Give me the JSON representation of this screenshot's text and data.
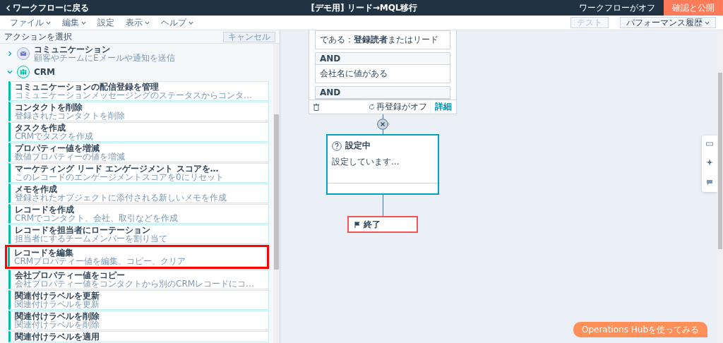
{
  "top_bar": {
    "back_link": "ワークフローに戻る",
    "title": "[デモ用] リード→MQL移行",
    "status": "ワークフローがオフ",
    "publish_button": "確認と公開"
  },
  "menu_bar": {
    "menus": [
      {
        "label": "ファイル",
        "dropdown": true
      },
      {
        "label": "編集",
        "dropdown": true
      },
      {
        "label": "設定",
        "dropdown": false
      },
      {
        "label": "表示",
        "dropdown": true
      },
      {
        "label": "ヘルプ",
        "dropdown": true
      }
    ],
    "buttons": [
      {
        "label": "テスト",
        "disabled": true,
        "dropdown": false
      },
      {
        "label": "パフォーマンス履歴",
        "disabled": false,
        "dropdown": true
      }
    ]
  },
  "sidebar": {
    "title": "アクションを選択",
    "cancel_button": "キャンセル",
    "categories": [
      {
        "name": "コミュニケーション",
        "description": "顧客やチームにEメールや通知を送信",
        "kind": "mail",
        "expanded": false
      },
      {
        "name": "CRM",
        "kind": "people",
        "expanded": true,
        "children": [
          {
            "title": "コミュニケーションの配信登録を管理",
            "description": "コミュニケーションメッセージングのステータスからコンタ…",
            "highlighted": false
          },
          {
            "title": "コンタクトを削除",
            "description": "登録されたコンタクトを削除",
            "highlighted": false
          },
          {
            "title": "タスクを作成",
            "description": "CRMでタスクを作成",
            "highlighted": false
          },
          {
            "title": "プロパティー値を増減",
            "description": "数値プロパティーの値を増減",
            "highlighted": false
          },
          {
            "title": "マーケティング リード エンゲージメント スコアを…",
            "description": "このレコードのエンゲージメントスコアを0にリセット",
            "highlighted": false
          },
          {
            "title": "メモを作成",
            "description": "登録されたオブジェクトに添付される新しいメモを作成",
            "highlighted": false
          },
          {
            "title": "レコードを作成",
            "description": "CRMでコンタクト、会社、取引などを作成",
            "highlighted": false
          },
          {
            "title": "レコードを担当者にローテーション",
            "description": "担当者にするチームメンバーを割り当て",
            "highlighted": false
          },
          {
            "title": "レコードを編集",
            "description": "CRMプロパティー値を編集、コピー、クリア",
            "highlighted": true
          },
          {
            "title": "会社プロパティー値をコピー",
            "description": "会社プロパティー値をコンタクトから別のCRMレコードにコ…",
            "highlighted": false
          },
          {
            "title": "関連付けラベルを更新",
            "description": "関連付けラベルを更新",
            "highlighted": false
          },
          {
            "title": "関連付けラベルを削除",
            "description": "関連付けラベルを削除",
            "highlighted": false
          },
          {
            "title": "関連付けラベルを適用",
            "highlighted": false
          }
        ]
      }
    ]
  },
  "canvas": {
    "condition_card": {
      "blocks": [
        {
          "text": "である：**登録読者**またはリード"
        },
        {
          "label": "AND",
          "text": "会社名に値がある"
        },
        {
          "label": "AND"
        }
      ],
      "reenroll": "再登録がオフ",
      "details_link": "詳細"
    },
    "pending_step": {
      "status": "設定中",
      "text": "設定しています..."
    },
    "end_step": {
      "label": "終了"
    },
    "cta_button": "Operations Hubを使ってみる"
  }
}
